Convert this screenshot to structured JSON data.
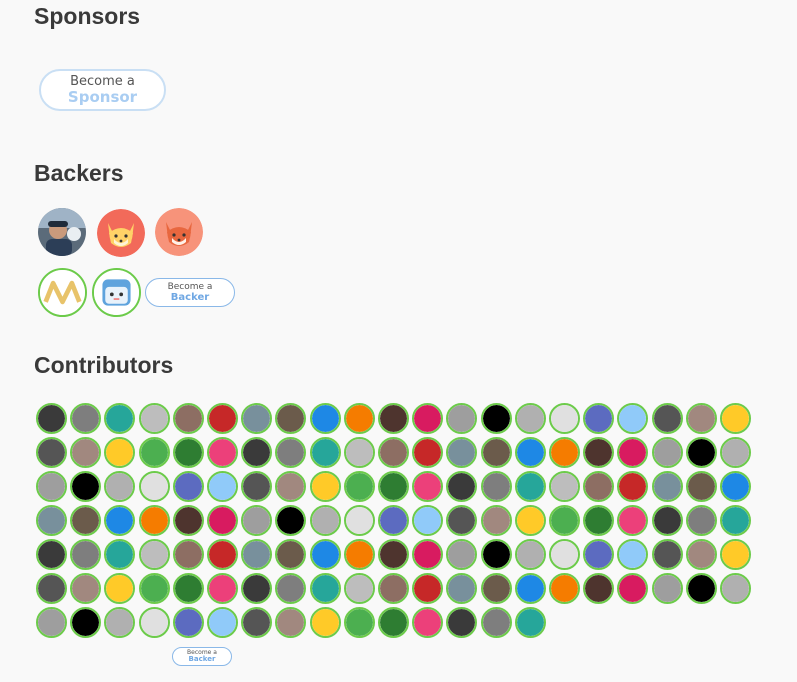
{
  "sections": {
    "sponsors_title": "Sponsors",
    "backers_title": "Backers",
    "contributors_title": "Contributors"
  },
  "sponsor_button": {
    "line1": "Become a",
    "line2": "Sponsor"
  },
  "backer_button": {
    "line1": "Become a",
    "line2": "Backer"
  },
  "contributor_backer_button": {
    "line1": "Become a",
    "line2": "Backer"
  },
  "colors": {
    "contributor_ring": "#6ccb4a",
    "button_border": "#c9dff4",
    "button_accent": "#a9cdf2"
  },
  "backers": [
    {
      "name": "backer-photo-avatar",
      "icon": "person-photo"
    },
    {
      "name": "backer-fox-avatar-1",
      "icon": "fox-icon"
    },
    {
      "name": "backer-fox-avatar-2",
      "icon": "fox-icon"
    },
    {
      "name": "backer-wave-logo-avatar",
      "icon": "zigzag-logo-icon"
    },
    {
      "name": "backer-blue-face-avatar",
      "icon": "cartoon-face-icon"
    }
  ],
  "contributor_count": 141
}
